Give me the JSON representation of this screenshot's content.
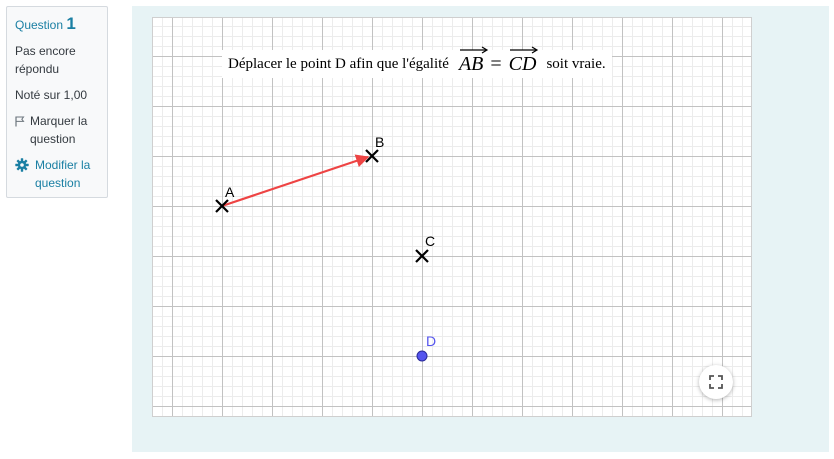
{
  "info": {
    "question_label": "Question",
    "question_number": "1",
    "state": "Pas encore répondu",
    "grade": "Noté sur 1,00",
    "flag_label": "Marquer la question",
    "edit_label": "Modifier la question"
  },
  "prompt": {
    "text": "Déplacer le point D afin que l'égalité",
    "vec1": "AB",
    "equals": "=",
    "vec2": "CD",
    "suffix": "soit vraie."
  },
  "points": {
    "A": "A",
    "B": "B",
    "C": "C",
    "D": "D"
  },
  "colors": {
    "accent": "#1a7fa3",
    "vector": "#ee4444",
    "point_d": "#5555ee",
    "panel_bg": "#e7f3f5"
  },
  "icons": {
    "flag": "flag-icon",
    "edit": "gear-icon",
    "fullscreen": "fullscreen-icon"
  }
}
